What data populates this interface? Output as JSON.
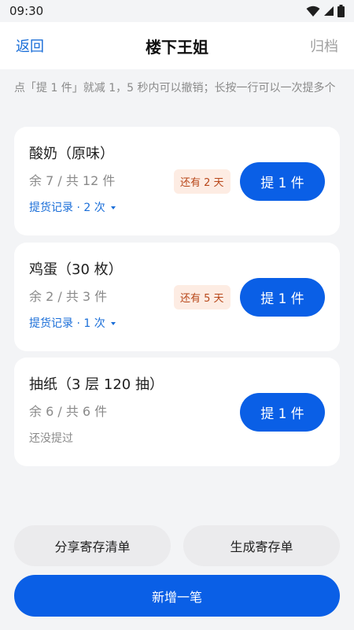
{
  "status_bar": {
    "time": "09:30"
  },
  "header": {
    "back_label": "返回",
    "title": "楼下王姐",
    "archive_label": "归档"
  },
  "hint": "点「提 1 件」就减 1，5 秒内可以撤销；长按一行可以一次提多个",
  "items": [
    {
      "name": "酸奶（原味）",
      "count": "余 7 / 共 12 件",
      "history": "提货记录 · 2 次",
      "badge": "还有 2 天",
      "button": "提 1 件"
    },
    {
      "name": "鸡蛋（30 枚）",
      "count": "余 2 / 共 3 件",
      "history": "提货记录 · 1 次",
      "badge": "还有 5 天",
      "button": "提 1 件"
    },
    {
      "name": "抽纸（3 层 120 抽）",
      "count": "余 6 / 共 6 件",
      "history": "还没提过",
      "badge": "",
      "button": "提 1 件"
    }
  ],
  "footer": {
    "share_label": "分享寄存清单",
    "generate_label": "生成寄存单",
    "add_label": "新增一笔"
  },
  "colors": {
    "accent": "#0a5fe6",
    "link": "#1a6ed8",
    "badge_bg": "#fdece3",
    "badge_text": "#b8471a",
    "page_bg": "#f3f4f6"
  },
  "icons": [
    "wifi-icon",
    "signal-icon",
    "battery-icon",
    "dropdown-triangle-icon"
  ]
}
